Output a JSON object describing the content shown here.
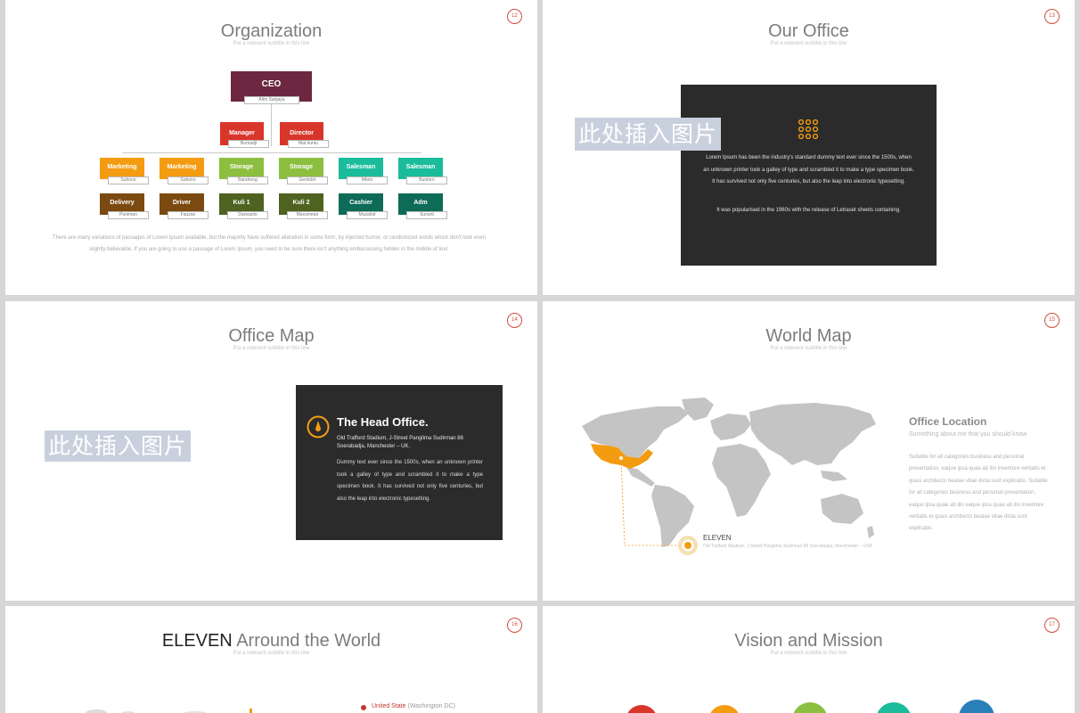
{
  "slides": [
    {
      "number": "12",
      "title": "Organization",
      "subtitle": "Put a relevant subtitle in this line"
    },
    {
      "number": "13",
      "title": "Our Office",
      "subtitle": "Put a relevant subtitle in this line"
    },
    {
      "number": "14",
      "title": "Office Map",
      "subtitle": "Put a relevant subtitle in this line"
    },
    {
      "number": "15",
      "title": "World Map",
      "subtitle": "Put a relevant subtitle in this line"
    },
    {
      "number": "16",
      "title_strong": "ELEVEN",
      "title_rest": "Arround the World",
      "subtitle": "Put a relevant subtitle in this line"
    },
    {
      "number": "17",
      "title": "Vision and Mission",
      "subtitle": "Put a relevant subtitle in this line"
    }
  ],
  "org": {
    "ceo": {
      "label": "CEO",
      "name": "Alim Sanjaya",
      "color": "#6d2741"
    },
    "manager": {
      "label": "Manager",
      "name": "Burnadji",
      "color": "#d8362a"
    },
    "director": {
      "label": "Director",
      "name": "Mat kuntu",
      "color": "#d8362a"
    },
    "row3": [
      {
        "label": "Marketing",
        "name": "Suhono",
        "color": "#f39c12"
      },
      {
        "label": "Marketing",
        "name": "Suhono",
        "color": "#f39c12"
      },
      {
        "label": "Storage",
        "name": "Bandreng",
        "color": "#8cbf3f"
      },
      {
        "label": "Storage",
        "name": "Gentolet",
        "color": "#8cbf3f"
      },
      {
        "label": "Salesman",
        "name": "Mbon",
        "color": "#1abc9c"
      },
      {
        "label": "Salesman",
        "name": "Buntoro",
        "color": "#1abc9c"
      }
    ],
    "row4": [
      {
        "label": "Delivery",
        "name": "Poniman",
        "color": "#7a4a10"
      },
      {
        "label": "Driver",
        "name": "Fauzan",
        "color": "#7a4a10"
      },
      {
        "label": "Kuli 1",
        "name": "Darwanto",
        "color": "#4e6320"
      },
      {
        "label": "Kuli 2",
        "name": "Mansmean",
        "color": "#4e6320"
      },
      {
        "label": "Cashier",
        "name": "Muzahid",
        "color": "#0d6b57"
      },
      {
        "label": "Adm",
        "name": "Sunarti",
        "color": "#0d6b57"
      }
    ],
    "body": "There are many variations of passages of Lorem Ipsum available, but the majority have suffered alteration in some form, by injected humor, or randomized words which don't look even slightly believable. If you are going to use a passage of Lorem Ipsum, you need to be sure there isn't anything embarrassing hidden in the middle of text."
  },
  "placeholder_text": "此处插入图片",
  "office": {
    "para1": "Lorem Ipsum has been the industry's standard dummy text ever since the 1500s,  when an unknown printer took a galley of type and scrambled it to make a type specimen book. It has survived not only five centuries, but also the leap into electronic typesetting.",
    "para2": "It was popularised in the 1960s  with the release of Letraset sheets containing."
  },
  "head_office": {
    "title": "The Head Office.",
    "address": "Old Trafford Stadium, J-Street Panglima Sudirman 86 Soerabadja, Manchester – UK.",
    "body": "Dummy text ever since the 1500s, when an unknown printer took a galley of type and scrambled it to make a type specimen book. It has survived not only five centuries, but also the leap into electronic typesetting."
  },
  "world_map": {
    "location_title": "Office Location",
    "location_sub": "Something about me that you should know",
    "location_body": "Suitable for all categories business and personal presentation, eaque ipsa quae ab illo inventore veritatis et quasi architecto beatae vitae dicta sunt explicabo. Suitable for all categories business and personal presentation, eaque ipsa quae ab illo eaque ipsa quae ab illo inventore veritatis et quasi architecto beatae vitae dicta sunt explicabo.",
    "pin_title": "ELEVEN",
    "pin_address": "Old Trafford Stadium, J-Street Panglima Sudirman 86 Soerabadja, Manchester – USA",
    "highlight_color": "#f39c12"
  },
  "around": {
    "legend_strong": "United State",
    "legend_rest": "(Washington DC)"
  },
  "vision_colors": [
    "#d8362a",
    "#f39c12",
    "#8cbf3f",
    "#1abc9c",
    "#2980b9"
  ]
}
